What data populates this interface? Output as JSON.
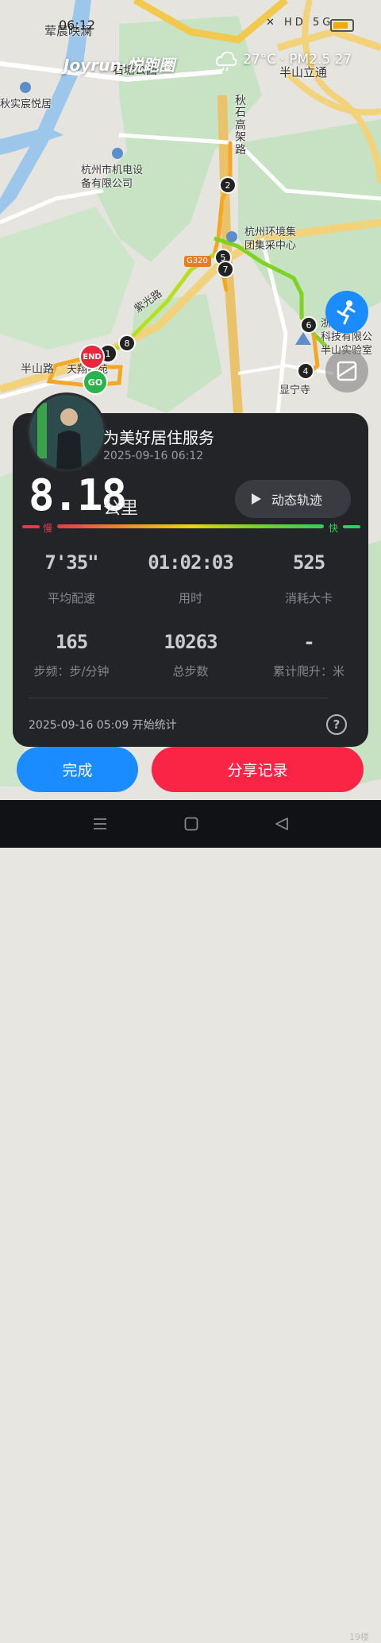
{
  "status_bar": {
    "time": "06:12",
    "icons": "✕ HD 5G"
  },
  "brand": "Joyrun·悦跑圈",
  "weather": {
    "text": "27°C · PM2.5 27",
    "icon": "cloud-icon"
  },
  "map_labels": {
    "label1": "荤晨映澜",
    "label2": "石塘公园",
    "label3": "半山立通",
    "label4": "秋石高架路",
    "label5": "秋实宸悦居",
    "label6": "杭州市机电设\n备有限公司",
    "label7": "杭州环境集\n团集采中心",
    "label8": "浙江省\n科技有限公\n半山实验室",
    "label9": "半山路",
    "label10": "显宁寺",
    "label11": "G320",
    "label12": "紫光路",
    "label13": "天翔西苑"
  },
  "markers": {
    "end": "END",
    "go": "GO",
    "numbers": [
      "1",
      "2",
      "4",
      "5",
      "6",
      "7",
      "8"
    ]
  },
  "run": {
    "title": "为美好居住服务",
    "datetime": "2025-09-16 06:12",
    "distance": "8.18",
    "unit": "公里",
    "replay_label": "动态轨迹",
    "pace_slow": "慢",
    "pace_fast": "快"
  },
  "stats": [
    {
      "value": "7'35\"",
      "label": "平均配速"
    },
    {
      "value": "01:02:03",
      "label": "用时"
    },
    {
      "value": "525",
      "label": "消耗大卡"
    },
    {
      "value": "165",
      "label": "步频：步/分钟"
    },
    {
      "value": "10263",
      "label": "总步数"
    },
    {
      "value": "-",
      "label": "累计爬升：米"
    }
  ],
  "start_text": "2025-09-16 05:09 开始统计",
  "buttons": {
    "done": "完成",
    "share": "分享记录"
  },
  "colors": {
    "done": "#1a8cff",
    "share": "#fa2444",
    "route_fast": "#7ed321",
    "route_slow": "#f5a623"
  },
  "watermark": "19楼"
}
